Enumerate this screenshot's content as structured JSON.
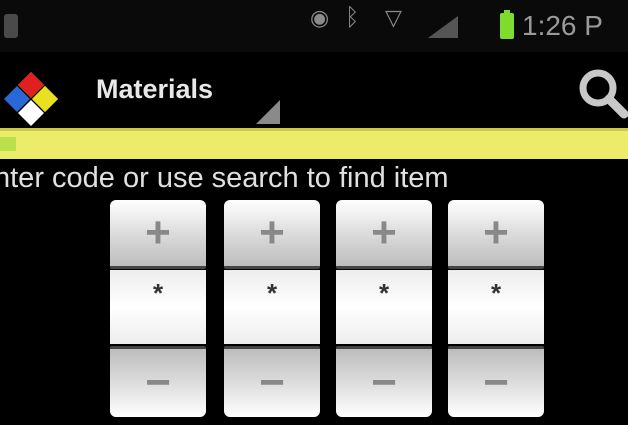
{
  "status_bar": {
    "time": "1:26 P",
    "icons": [
      "eye-icon",
      "bluetooth-icon",
      "wifi-icon",
      "signal-icon",
      "battery-icon"
    ]
  },
  "action_bar": {
    "title": "Materials",
    "logo_icon": "hazard-diamond-icon",
    "search_icon": "search-icon"
  },
  "instruction": "nter code or use search to find item",
  "code_wheels": [
    {
      "up": "+",
      "value": "*",
      "down": "−"
    },
    {
      "up": "+",
      "value": "*",
      "down": "−"
    },
    {
      "up": "+",
      "value": "*",
      "down": "−"
    },
    {
      "up": "+",
      "value": "*",
      "down": "−"
    }
  ],
  "colors": {
    "highlight_bar": "#ecec6a",
    "battery": "#7ddc2e",
    "background": "#000000"
  }
}
